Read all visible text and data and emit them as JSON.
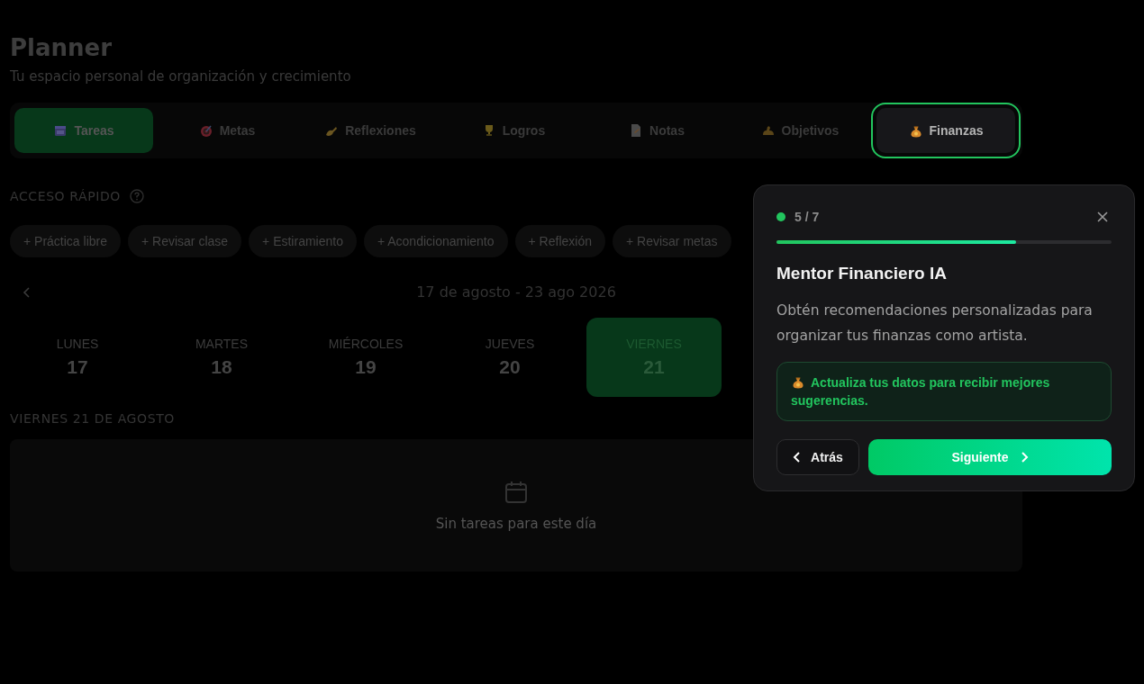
{
  "header": {
    "title": "Planner",
    "subtitle": "Tu espacio personal de organización y crecimiento"
  },
  "tabs": [
    {
      "label": "Tareas",
      "selected": true,
      "highlighted": false
    },
    {
      "label": "Metas",
      "selected": false,
      "highlighted": false
    },
    {
      "label": "Reflexiones",
      "selected": false,
      "highlighted": false
    },
    {
      "label": "Logros",
      "selected": false,
      "highlighted": false
    },
    {
      "label": "Notas",
      "selected": false,
      "highlighted": false
    },
    {
      "label": "Objetivos",
      "selected": false,
      "highlighted": false
    },
    {
      "label": "Finanzas",
      "selected": false,
      "highlighted": true
    }
  ],
  "quick_access": {
    "heading": "ACCESO RÁPIDO",
    "chips": [
      "+ Práctica libre",
      "+ Revisar clase",
      "+ Estiramiento",
      "+ Acondicionamiento",
      "+ Reflexión",
      "+ Revisar metas"
    ]
  },
  "week": {
    "range": "17 de agosto - 23 ago 2026",
    "days": [
      {
        "name": "LUNES",
        "number": "17",
        "selected": false
      },
      {
        "name": "MARTES",
        "number": "18",
        "selected": false
      },
      {
        "name": "MIÉRCOLES",
        "number": "19",
        "selected": false
      },
      {
        "name": "JUEVES",
        "number": "20",
        "selected": false
      },
      {
        "name": "VIERNES",
        "number": "21",
        "selected": true
      }
    ]
  },
  "day_panel": {
    "heading": "VIERNES 21 DE AGOSTO",
    "empty_text": "Sin tareas para este día"
  },
  "tour": {
    "step": "5 / 7",
    "level": 0.714,
    "title": "Mentor Financiero IA",
    "description": "Obtén recomendaciones personalizadas para organizar tus finanzas como artista.",
    "tip": "Actualiza tus datos para recibir mejores sugerencias.",
    "back": "Atrás",
    "next": "Siguiente"
  }
}
